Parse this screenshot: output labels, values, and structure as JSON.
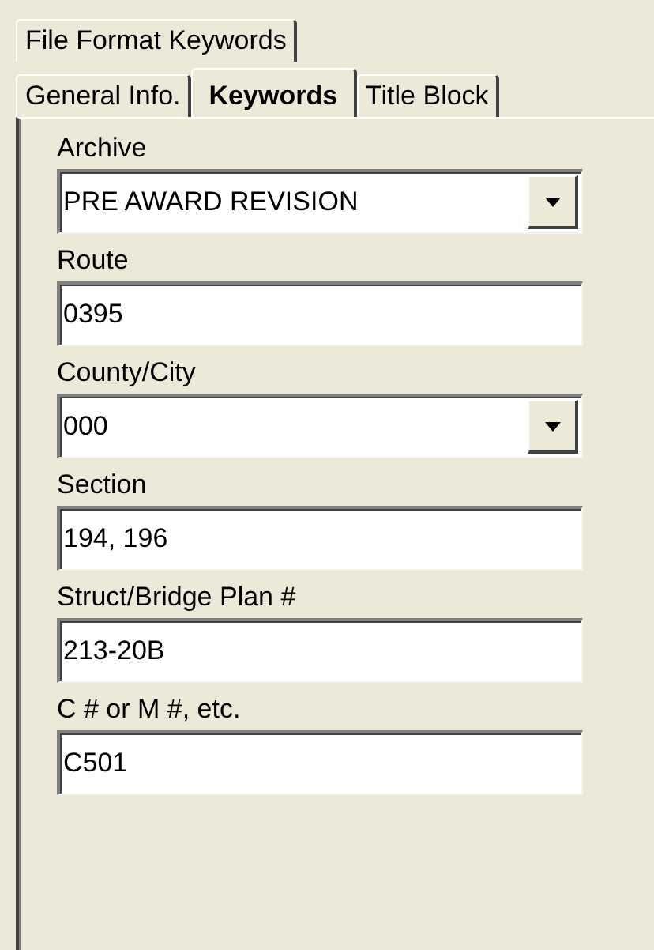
{
  "outer_tabs": [
    {
      "label": "File Format Keywords"
    }
  ],
  "tabs": [
    {
      "label": "General Info.",
      "selected": false
    },
    {
      "label": "Keywords",
      "selected": true
    },
    {
      "label": "Title Block",
      "selected": false
    }
  ],
  "fields": [
    {
      "label": "Archive",
      "value": "PRE AWARD REVISION",
      "kind": "combo"
    },
    {
      "label": "Route",
      "value": "0395",
      "kind": "text"
    },
    {
      "label": "County/City",
      "value": "000",
      "kind": "combo"
    },
    {
      "label": "Section",
      "value": "194, 196",
      "kind": "text"
    },
    {
      "label": "Struct/Bridge Plan #",
      "value": "213-20B",
      "kind": "text"
    },
    {
      "label": "C # or M #, etc.",
      "value": "C501",
      "kind": "text"
    }
  ]
}
